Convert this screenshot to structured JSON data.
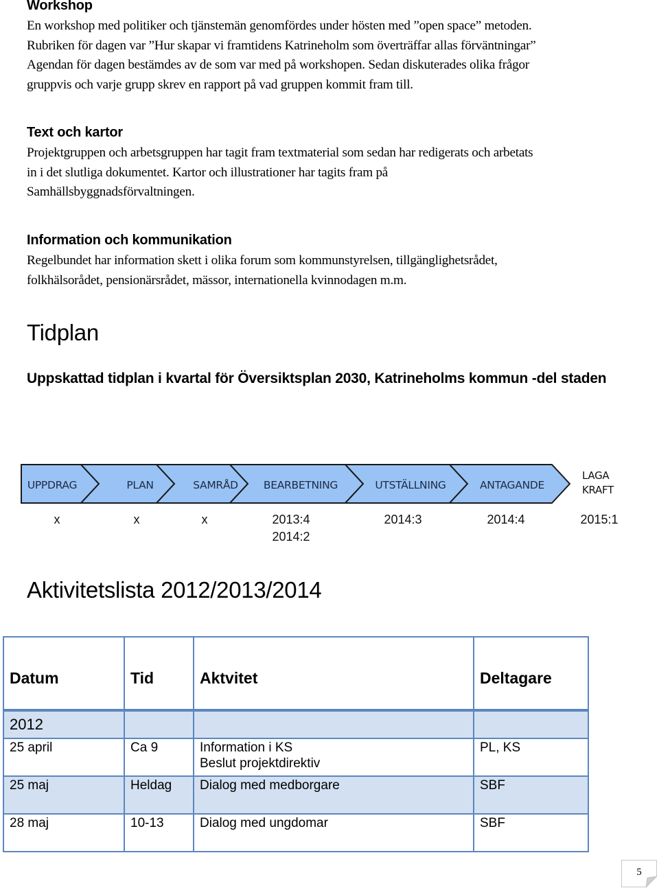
{
  "sections": {
    "workshop": {
      "heading": "Workshop",
      "lines": [
        "En workshop med politiker och tjänstemän genomfördes under hösten med ”open space” metoden.",
        "Rubriken för dagen var ”Hur skapar vi framtidens Katrineholm som överträffar allas förväntningar”",
        "Agendan för dagen bestämdes av de som var med på workshopen. Sedan diskuterades olika frågor",
        "gruppvis och varje grupp skrev en rapport på vad gruppen kommit fram till."
      ]
    },
    "text_och_kartor": {
      "heading": "Text och kartor",
      "lines": [
        "Projektgruppen och arbetsgruppen har tagit fram textmaterial som sedan har redigerats och arbetats",
        "in i det slutliga dokumentet. Kartor och illustrationer har tagits fram på",
        "Samhällsbyggnadsförvaltningen."
      ]
    },
    "information": {
      "heading": "Information och kommunikation",
      "lines": [
        "Regelbundet har information skett i olika forum som kommunstyrelsen, tillgänglighetsrådet,",
        "folkhälsorådet, pensionärsrådet, mässor, internationella kvinnodagen m.m."
      ]
    }
  },
  "tidplan": {
    "title": "Tidplan",
    "subtitle": "Uppskattad tidplan i kvartal för Översiktsplan 2030, Katrineholms kommun -del staden",
    "fill_color": "#99c3f5",
    "stroke_color": "#1a1a1a",
    "label_color": "#1f2a44",
    "phases": [
      {
        "label": "UPPDRAG",
        "dates": [
          "x"
        ]
      },
      {
        "label": "PLAN",
        "dates": [
          "x"
        ]
      },
      {
        "label": "SAMRÅD",
        "dates": [
          "x"
        ]
      },
      {
        "label": "BEARBETNING",
        "dates": [
          "2013:4",
          "2014:2"
        ]
      },
      {
        "label": "UTSTÄLLNING",
        "dates": [
          "2014:3"
        ]
      },
      {
        "label": "ANTAGANDE",
        "dates": [
          "2014:4"
        ]
      }
    ],
    "final": {
      "label_lines": [
        "LAGA",
        "KRAFT"
      ],
      "dates": [
        "2015:1"
      ]
    }
  },
  "activity_list": {
    "title": "Aktivitetslista 2012/2013/2014",
    "columns": [
      "Datum",
      "Tid",
      "Aktvitet",
      "Deltagare"
    ],
    "year_row": "2012",
    "rows": [
      {
        "datum": "25 april",
        "tid": "Ca 9",
        "aktivitet": [
          "Information i KS",
          "Beslut projektdirektiv"
        ],
        "deltagare": "PL, KS"
      },
      {
        "datum": "25 maj",
        "tid": "Heldag",
        "aktivitet": [
          "Dialog med medborgare"
        ],
        "deltagare": "SBF"
      },
      {
        "datum": "28 maj",
        "tid": "10-13",
        "aktivitet": [
          "Dialog med ungdomar"
        ],
        "deltagare": "SBF"
      }
    ]
  },
  "page_number": "5"
}
